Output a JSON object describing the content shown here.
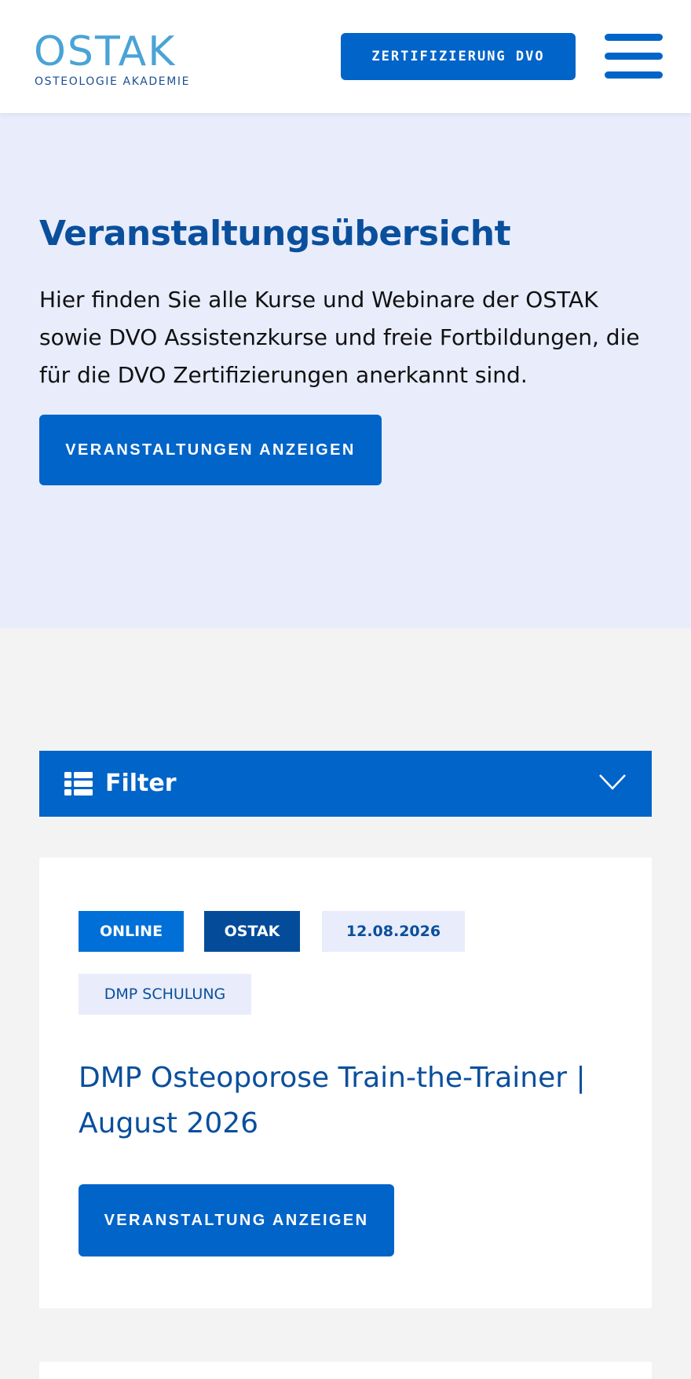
{
  "header": {
    "logo_word": "OSTAK",
    "logo_subtitle": "OSTEOLOGIE AKADEMIE",
    "cert_button_label": "ZERTIFIZIERUNG DVO",
    "menu_icon": "hamburger-menu-icon"
  },
  "hero": {
    "title": "Veranstaltungsübersicht",
    "text": "Hier finden Sie alle Kurse und Webinare der OSTAK sowie DVO Assistenzkurse und freie Fortbildungen, die für die DVO Zertifizierungen anerkannt sind.",
    "button_label": "VERANSTALTUNGEN ANZEIGEN"
  },
  "filter": {
    "label": "Filter",
    "icon": "list-icon",
    "toggle_icon": "chevron-down-icon"
  },
  "events": [
    {
      "tags": {
        "format": "ONLINE",
        "provider": "OSTAK",
        "date": "12.08.2026",
        "category": "DMP SCHULUNG"
      },
      "title": "DMP Osteoporose Train-the-Trainer | August 2026",
      "button_label": "VERANSTALTUNG ANZEIGEN"
    }
  ],
  "colors": {
    "primary": "#0064c8",
    "dark_blue": "#044c9a",
    "heading_blue": "#0a4f9c",
    "hero_bg": "#e8ecfb",
    "page_bg": "#f3f3f3"
  }
}
